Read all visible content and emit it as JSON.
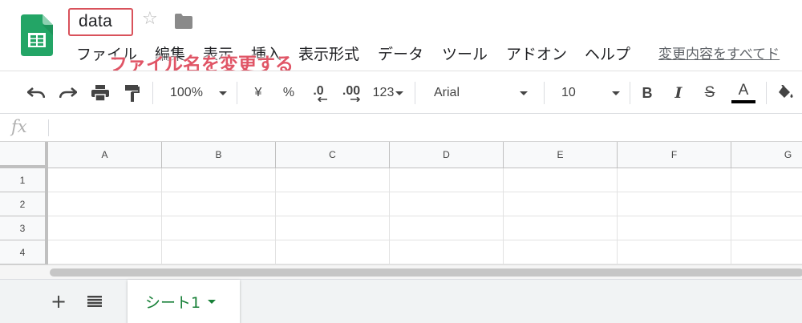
{
  "header": {
    "title": "data",
    "change_notice": "変更内容をすべてド"
  },
  "menu": [
    {
      "id": "file",
      "label": "ファイル"
    },
    {
      "id": "edit",
      "label": "編集"
    },
    {
      "id": "view",
      "label": "表示"
    },
    {
      "id": "insert",
      "label": "挿入"
    },
    {
      "id": "format",
      "label": "表示形式"
    },
    {
      "id": "data",
      "label": "データ"
    },
    {
      "id": "tools",
      "label": "ツール"
    },
    {
      "id": "addons",
      "label": "アドオン"
    },
    {
      "id": "help",
      "label": "ヘルプ"
    }
  ],
  "annotation": "ファイル名を変更する",
  "toolbar": {
    "zoom": "100%",
    "currency": "¥",
    "percent": "%",
    "decrease_decimal": ".0",
    "increase_decimal": ".00",
    "more_formats": "123",
    "font": "Arial",
    "font_size": "10",
    "bold": "B",
    "italic": "I",
    "strike": "S",
    "text_color": "A"
  },
  "formula_bar": {
    "fx": "fx"
  },
  "grid": {
    "columns": [
      "A",
      "B",
      "C",
      "D",
      "E",
      "F",
      "G"
    ],
    "rows": [
      "1",
      "2",
      "3",
      "4"
    ]
  },
  "sheets": {
    "add_label": "+",
    "tabs": [
      {
        "label": "シート1"
      }
    ]
  },
  "colors": {
    "accent_green": "#188038",
    "annotation_red": "#e05566"
  }
}
